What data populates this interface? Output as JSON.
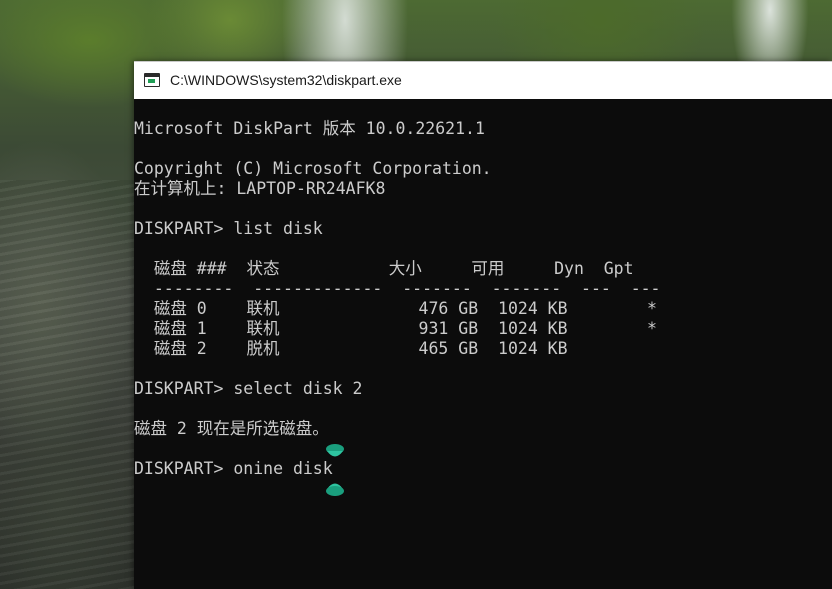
{
  "window": {
    "title": "C:\\WINDOWS\\system32\\diskpart.exe"
  },
  "console": {
    "lines": [
      "Microsoft DiskPart 版本 10.0.22621.1",
      "",
      "Copyright (C) Microsoft Corporation.",
      "在计算机上: LAPTOP-RR24AFK8",
      "",
      "DISKPART> list disk",
      "",
      "  磁盘 ###  状态           大小     可用     Dyn  Gpt",
      "  --------  -------------  -------  -------  ---  ---",
      "  磁盘 0    联机              476 GB  1024 KB        *",
      "  磁盘 1    联机              931 GB  1024 KB        *",
      "  磁盘 2    脱机              465 GB  1024 KB",
      "",
      "DISKPART> select disk 2",
      "",
      "磁盘 2 现在是所选磁盘。",
      "",
      "DISKPART> onine disk"
    ]
  },
  "cursor": {
    "icon": "busy-hourglass-icon",
    "color": "#2ec4a0"
  }
}
